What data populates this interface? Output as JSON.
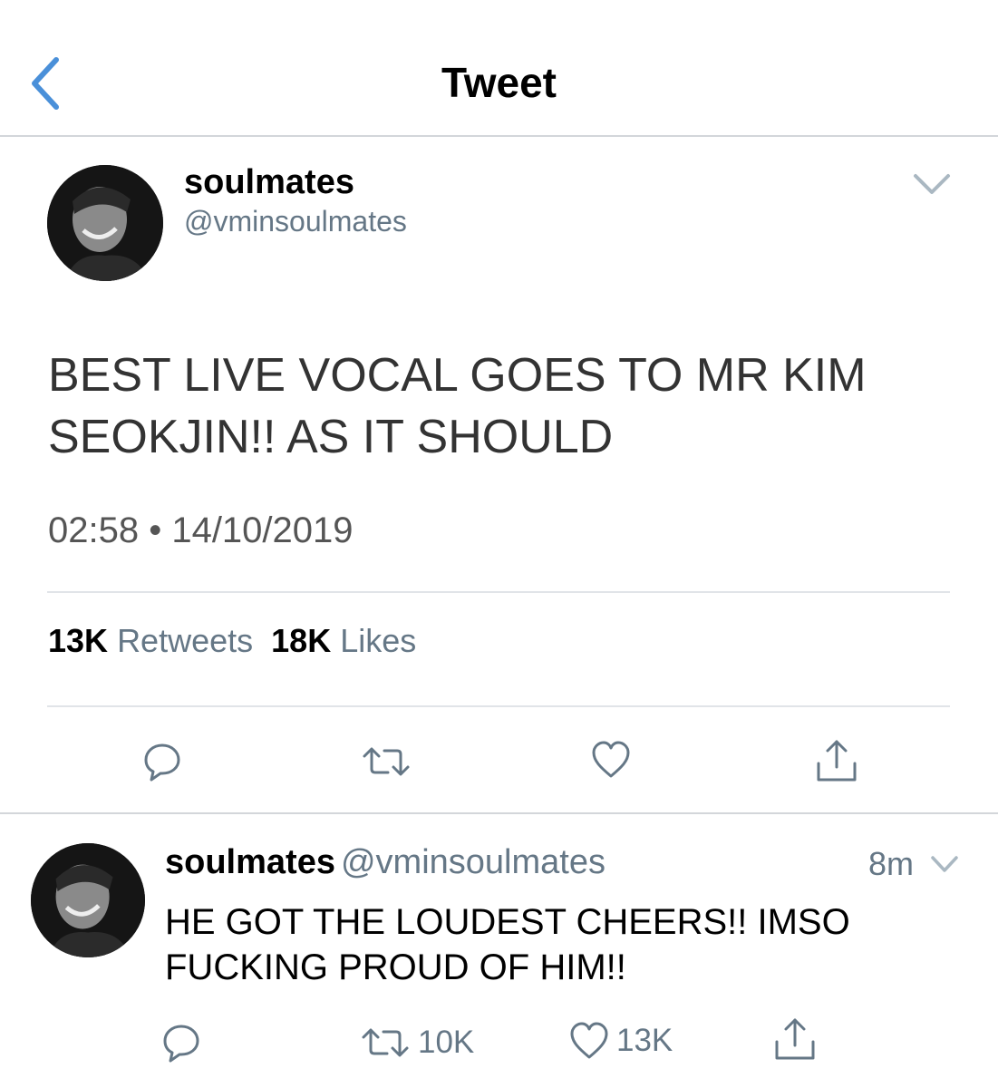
{
  "header": {
    "title": "Tweet",
    "back_icon": "chevron-left-icon",
    "accent": "#4a90d9"
  },
  "tweet": {
    "display_name": "soulmates",
    "handle": "@vminsoulmates",
    "text": "BEST LIVE VOCAL GOES TO MR KIM SEOKJIN!! AS IT SHOULD",
    "timestamp": "02:58 • 14/10/2019",
    "retweets_count": "13K",
    "retweets_label": "Retweets",
    "likes_count": "18K",
    "likes_label": "Likes",
    "actions": [
      "reply-icon",
      "retweet-icon",
      "like-icon",
      "share-icon"
    ]
  },
  "reply": {
    "display_name": "soulmates",
    "handle": "@vminsoulmates",
    "time": "8m",
    "text": "HE GOT THE LOUDEST CHEERS!! IMSO FUCKING PROUD OF HIM!!",
    "retweets": "10K",
    "likes": "13K"
  }
}
